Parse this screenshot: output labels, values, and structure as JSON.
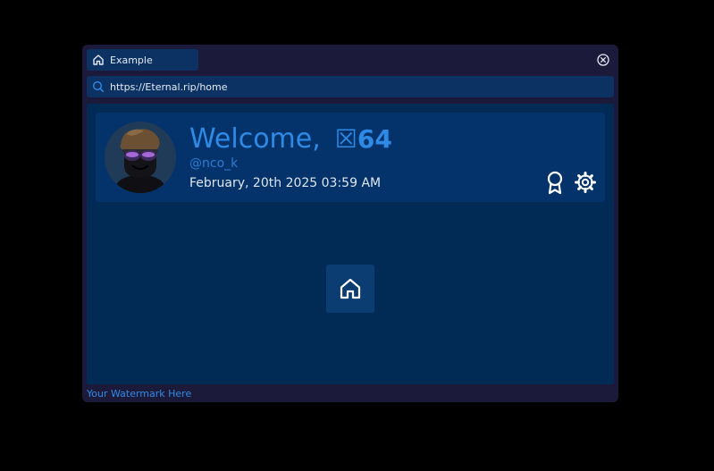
{
  "tab": {
    "label": "Example",
    "icon": "home-icon"
  },
  "window": {
    "close_icon": "close-circle-icon"
  },
  "urlbar": {
    "icon": "search-icon",
    "url": "https://Eternal.rip/home"
  },
  "profile": {
    "avatar_icon": "avatar",
    "welcome_label": "Welcome,",
    "display_name": "☒64",
    "handle": "@nco_k",
    "datetime": "February, 20th 2025 03:59 AM"
  },
  "actions": {
    "badge_icon": "award-icon",
    "settings_icon": "gear-icon"
  },
  "home_button": {
    "icon": "home-icon"
  },
  "footer": {
    "watermark": "Your Watermark Here"
  },
  "colors": {
    "accent": "#2f8ae6",
    "window_bg": "#1c1a3a",
    "panel_bg": "#012a55",
    "bar_bg": "#0b3262"
  }
}
